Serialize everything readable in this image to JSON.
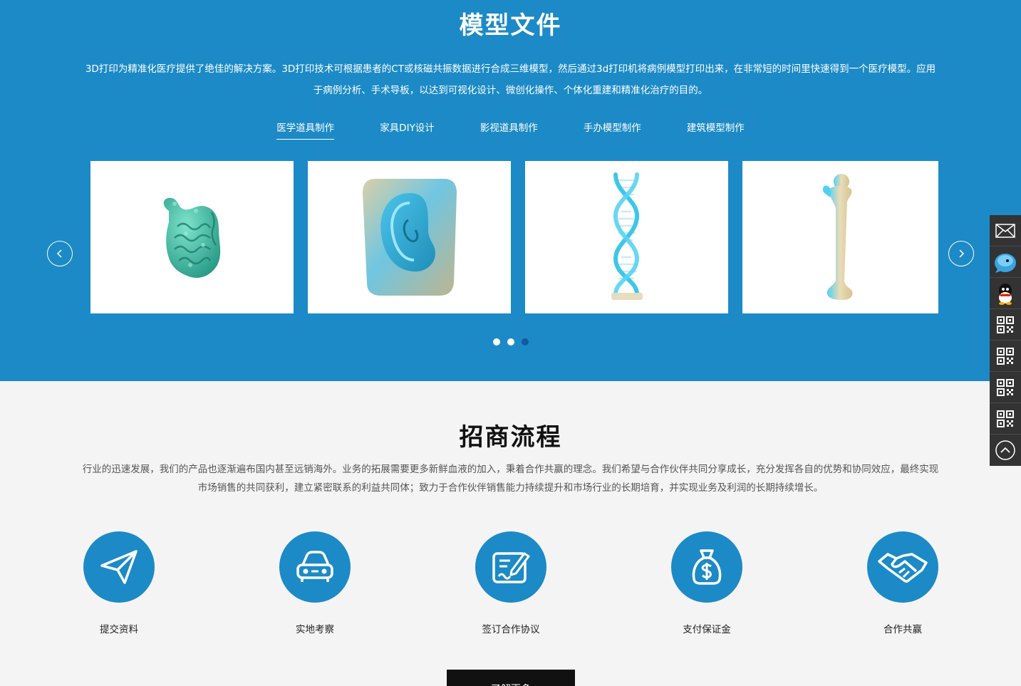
{
  "models": {
    "title": "模型文件",
    "description": "3D打印为精准化医疗提供了绝佳的解决方案。3D打印技术可根据患者的CT或核磁共振数据进行合成三维模型，然后通过3d打印机将病例模型打印出来，在非常短的时间里快速得到一个医疗模型。应用于病例分析、手术导板，以达到可视化设计、微创化操作、个体化重建和精准化治疗的目的。",
    "tabs": [
      {
        "label": "医学道具制作",
        "active": true
      },
      {
        "label": "家具DIY设计",
        "active": false
      },
      {
        "label": "影视道具制作",
        "active": false
      },
      {
        "label": "手办模型制作",
        "active": false
      },
      {
        "label": "建筑模型制作",
        "active": false
      }
    ],
    "cards": [
      {
        "icon": "intestine-model-icon"
      },
      {
        "icon": "ear-model-icon"
      },
      {
        "icon": "dna-model-icon"
      },
      {
        "icon": "femur-model-icon"
      }
    ],
    "carousel": {
      "total_pages": 3,
      "active_page": 3
    },
    "colors": {
      "background": "#1c8ac6",
      "active_dot": "#1357a6"
    }
  },
  "process": {
    "title": "招商流程",
    "description": "行业的迅速发展，我们的产品也逐渐遍布国内甚至远销海外。业务的拓展需要更多新鲜血液的加入，秉着合作共赢的理念。我们希望与合作伙伴共同分享成长，充分发挥各自的优势和协同效应，最终实现市场销售的共同获利，建立紧密联系的利益共同体；致力于合作伙伴销售能力持续提升和市场行业的长期培育，并实现业务及利润的长期持续增长。",
    "steps": [
      {
        "label": "提交资料",
        "icon": "paper-plane-icon"
      },
      {
        "label": "实地考察",
        "icon": "car-icon"
      },
      {
        "label": "签订合作协议",
        "icon": "sign-contract-icon"
      },
      {
        "label": "支付保证金",
        "icon": "money-bag-icon"
      },
      {
        "label": "合作共赢",
        "icon": "handshake-icon"
      }
    ],
    "more_button": "了解更多"
  },
  "side_bar": {
    "items": [
      "mail-icon",
      "chat-icon",
      "qq-icon",
      "qrcode-icon",
      "qrcode-icon",
      "qrcode-icon",
      "qrcode-icon",
      "back-to-top-icon"
    ]
  }
}
